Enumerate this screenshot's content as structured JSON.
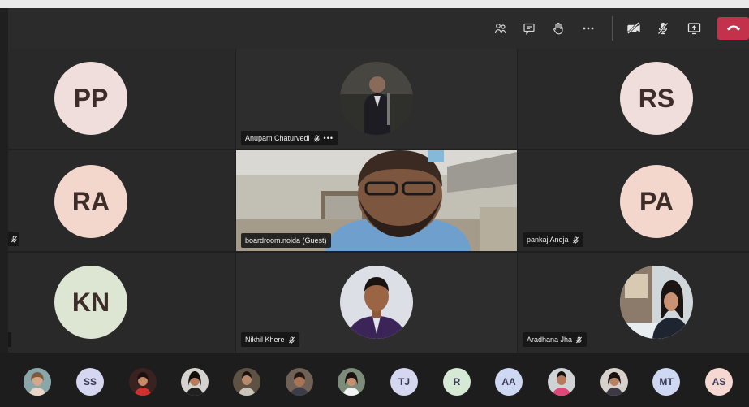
{
  "toolbar": {
    "icons": [
      "participants-icon",
      "chat-icon",
      "raise-hand-icon",
      "more-options-icon",
      "camera-off-icon",
      "mic-off-icon",
      "share-screen-icon",
      "hang-up-icon"
    ],
    "hangup_color": "#c4314b"
  },
  "tiles": {
    "pp": {
      "initials": "PP",
      "color": "#efdedb"
    },
    "anupam": {
      "name": "Anupam Chaturvedi"
    },
    "rs": {
      "initials": "RS",
      "color": "#efdedb"
    },
    "ra": {
      "initials": "RA",
      "color": "#f3d6cc"
    },
    "boardroom": {
      "name": "boardroom.noida (Guest)"
    },
    "pa": {
      "initials": "PA",
      "color": "#f3d6cc"
    },
    "kn": {
      "initials": "KN",
      "color": "#dde6d3"
    },
    "nikhil": {
      "name": "Nikhil Khere"
    },
    "pankaj": {
      "name": "pankaj Aneja"
    },
    "aradhana": {
      "name": "Aradhana Jha"
    }
  },
  "overflow": {
    "ss": {
      "initials": "SS",
      "color": "#d5d6ef"
    },
    "tj": {
      "initials": "TJ",
      "color": "#d5d6ef"
    },
    "r": {
      "initials": "R",
      "color": "#d6e9d4"
    },
    "aa": {
      "initials": "AA",
      "color": "#cfd8f2"
    },
    "mt": {
      "initials": "MT",
      "color": "#cfd8f2"
    },
    "as": {
      "initials": "AS",
      "color": "#f6d8d2"
    }
  }
}
